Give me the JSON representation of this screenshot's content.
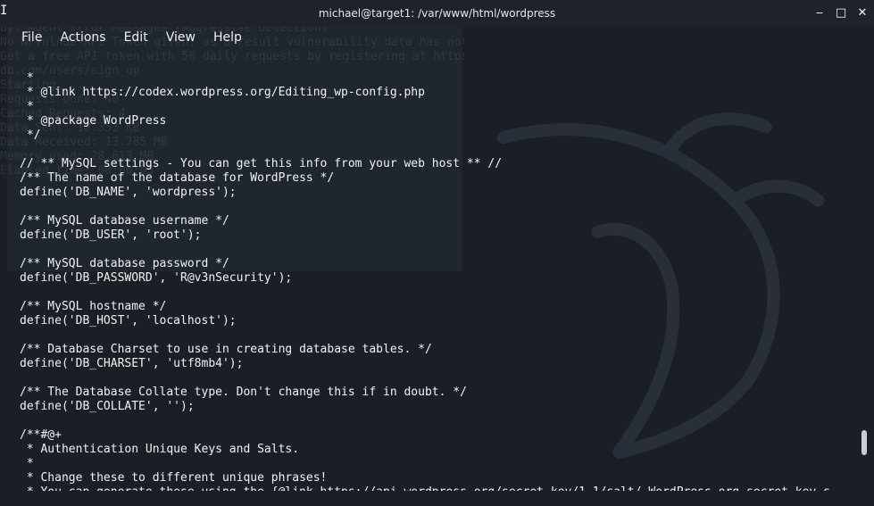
{
  "window": {
    "title": "michael@target1: /var/www/html/wordpress",
    "controls": {
      "minimize": "‒",
      "maximize": "□",
      "close": "✕"
    }
  },
  "menu": {
    "items": [
      "File",
      "Actions",
      "Edit",
      "View",
      "Help"
    ]
  },
  "background_text": [
    "Author-ID Brute Forcing - Author Pattern (Aggressive Detection)",
    "By: Agent Error Messages (Aggressive Detection)",
    "",
    "",
    "",
    "No WPVulnDB API Token given, as a result vulnerability data has not been output.",
    "Get a free API token with 50 daily requests by registering at https",
    "db.com/users/sign_up",
    "",
    "Starting. ...",
    "Requests Done: 48",
    "Cached Requests: 4",
    "Data Sent: 10.353 KB",
    "",
    "Data Received: 13.785 MB",
    "Memory used: 28.613 MB",
    "Elapsed time: 00:00:05"
  ],
  "terminal": {
    "lines": [
      " *",
      " * @link https://codex.wordpress.org/Editing_wp-config.php",
      " *",
      " * @package WordPress",
      " */",
      "",
      "// ** MySQL settings - You can get this info from your web host ** //",
      "/** The name of the database for WordPress */",
      "define('DB_NAME', 'wordpress');",
      "",
      "/** MySQL database username */",
      "define('DB_USER', 'root');",
      "",
      "/** MySQL database password */",
      "define('DB_PASSWORD', 'R@v3nSecurity');",
      "",
      "/** MySQL hostname */",
      "define('DB_HOST', 'localhost');",
      "",
      "/** Database Charset to use in creating database tables. */",
      "define('DB_CHARSET', 'utf8mb4');",
      "",
      "/** The Database Collate type. Don't change this if in doubt. */",
      "define('DB_COLLATE', '');",
      "",
      "/**#@+",
      " * Authentication Unique Keys and Salts.",
      " *",
      " * Change these to different unique phrases!",
      " * You can generate these using the {@link https://api.wordpress.org/secret-key/1.1/salt/ WordPress.org secret-key s"
    ]
  },
  "colors": {
    "background": "#1a1f26",
    "text": "#f1f3f5",
    "titlebar": "#1e232a"
  }
}
